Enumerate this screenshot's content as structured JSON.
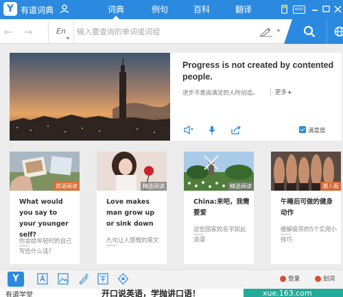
{
  "topbar": {
    "app_title": "有道词典",
    "tabs": [
      {
        "label": "词典",
        "active": true
      },
      {
        "label": "例句",
        "active": false
      },
      {
        "label": "百科",
        "active": false
      },
      {
        "label": "翻译",
        "active": false
      }
    ],
    "mini_label": "mini",
    "brand_color": "#2b8ae0"
  },
  "search": {
    "lang": "En",
    "placeholder": "输入要查询的单词或词组"
  },
  "featured": {
    "quote_en": "Progress is not created by contented people.",
    "quote_cn": "进步不是由满足的人所创造。",
    "more": "更多",
    "satisfaction": "满意度"
  },
  "cards": [
    {
      "badge": "双语阅读",
      "title": "What would you say to your younger self?",
      "sub": "你会给年轻时的自己写些什么话？"
    },
    {
      "badge": "精选阅读",
      "title": "Love makes man grow up or sink down",
      "sub": "九句让人感慨的英文"
    },
    {
      "badge": "精选阅读",
      "title": "China:来吧，我需要爱",
      "sub": "这些国家的名字如此浪漫"
    },
    {
      "badge": "潮人街",
      "title": "午睡后可做的健身动作",
      "sub": "缓解疲劳的5个实用小技巧"
    }
  ],
  "toolbar": {
    "right_items": [
      "登录",
      "划词"
    ]
  },
  "ad": {
    "left": "有道学堂",
    "mid": "开口说英语，学抛讲口语！",
    "right": "xue.163.com"
  }
}
